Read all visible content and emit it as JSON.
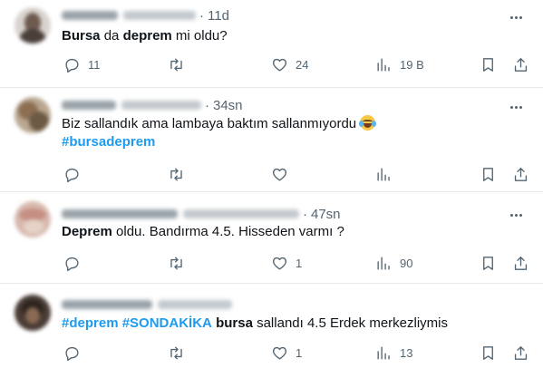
{
  "tweets": [
    {
      "time": "11d",
      "segments": [
        {
          "text": "Bursa",
          "style": "bold"
        },
        {
          "text": " da ",
          "style": "plain"
        },
        {
          "text": "deprem",
          "style": "bold"
        },
        {
          "text": " mi oldu?",
          "style": "plain"
        }
      ],
      "hashtag_line": "",
      "counts": {
        "reply": "11",
        "retweet": "",
        "like": "24",
        "views": "19 B"
      }
    },
    {
      "time": "34sn",
      "segments": [
        {
          "text": "Biz sallandık ama lambaya baktım sallanmıyordu",
          "style": "plain"
        }
      ],
      "emoji": "face-with-tears-of-joy",
      "hashtag_line": "#bursadeprem",
      "counts": {
        "reply": "",
        "retweet": "",
        "like": "",
        "views": ""
      }
    },
    {
      "time": "47sn",
      "segments": [
        {
          "text": "Deprem",
          "style": "bold"
        },
        {
          "text": " oldu. Bandırma 4.5. Hisseden varmı ?",
          "style": "plain"
        }
      ],
      "hashtag_line": "",
      "counts": {
        "reply": "",
        "retweet": "",
        "like": "1",
        "views": "90"
      }
    },
    {
      "time": "",
      "segments": [
        {
          "text": "#deprem",
          "style": "tag"
        },
        {
          "text": " ",
          "style": "plain"
        },
        {
          "text": "#SONDAKİKA",
          "style": "tag"
        },
        {
          "text": " ",
          "style": "plain"
        },
        {
          "text": "bursa",
          "style": "bold"
        },
        {
          "text": " sallandı 4.5 Erdek merkezliymis",
          "style": "plain"
        }
      ],
      "hashtag_line": "",
      "counts": {
        "reply": "",
        "retweet": "",
        "like": "1",
        "views": "13"
      }
    }
  ],
  "icons": {
    "reply": "reply-icon",
    "retweet": "retweet-icon",
    "like": "heart-icon",
    "views": "views-icon",
    "bookmark": "bookmark-icon",
    "share": "share-icon",
    "more": "more-icon"
  },
  "colors": {
    "accent": "#1d9bf0",
    "text": "#0f1419",
    "muted": "#536471",
    "divider": "#e7e9ea"
  }
}
